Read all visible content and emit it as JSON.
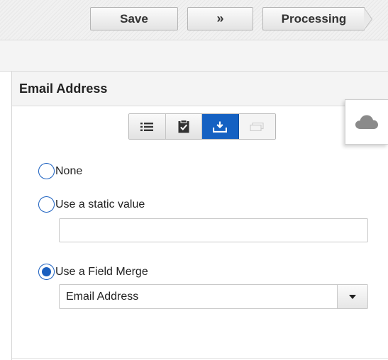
{
  "toolbar": {
    "save_label": "Save",
    "next_label": "»",
    "processing_label": "Processing"
  },
  "panel": {
    "title": "Email Address",
    "cloud_icon": "cloud-icon"
  },
  "segmented": {
    "buttons": [
      {
        "icon": "list-icon",
        "active": false
      },
      {
        "icon": "clipboard-check-icon",
        "active": false
      },
      {
        "icon": "download-tray-icon",
        "active": true
      },
      {
        "icon": "copy-icon",
        "active": false,
        "disabled": true
      }
    ]
  },
  "options": {
    "none_label": "None",
    "static_label": "Use a static value",
    "static_value": "",
    "merge_label": "Use a Field Merge",
    "selected": "merge"
  },
  "field_merge": {
    "selected_value": "Email Address"
  },
  "colors": {
    "accent": "#1a5fbf",
    "active_button": "#1561c2"
  }
}
